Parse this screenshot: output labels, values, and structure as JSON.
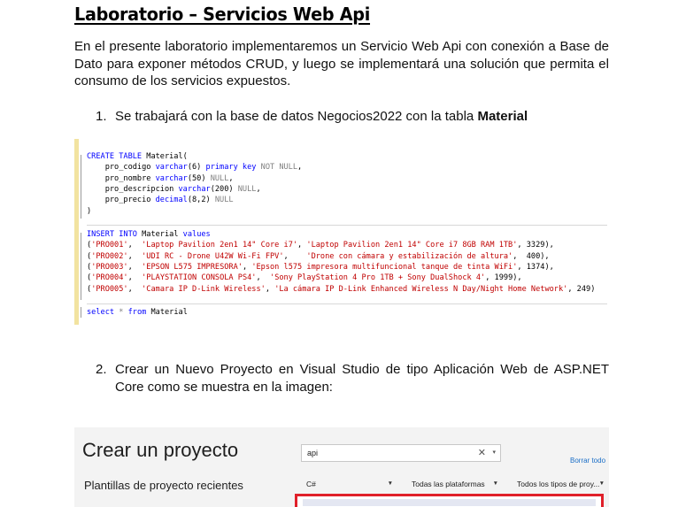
{
  "title": "Laboratorio – Servicios Web Api",
  "intro": "En el presente laboratorio implementaremos un Servicio Web Api con conexión a Base de Dato para exponer métodos CRUD, y luego se implementará una solución que permita el consumo de los servicios expuestos.",
  "steps": [
    {
      "num": "1.",
      "text_prefix": "Se trabajará con la base de datos Negocios2022 con la tabla ",
      "text_bold": "Material"
    },
    {
      "num": "2.",
      "text": "Crear un Nuevo Proyecto en Visual Studio de tipo Aplicación Web de ASP.NET Core como se muestra en la imagen:"
    }
  ],
  "code": {
    "create_table": [
      "CREATE TABLE Material(",
      "    pro_codigo varchar(6) primary key NOT NULL,",
      "    pro_nombre varchar(50) NULL,",
      "    pro_descripcion varchar(200) NULL,",
      "    pro_precio decimal(8,2) NULL",
      ")"
    ],
    "insert": [
      "INSERT INTO Material values",
      "('PRO001',  'Laptop Pavilion 2en1 14\" Core i7', 'Laptop Pavilion 2en1 14\" Core i7 8GB RAM 1TB', 3329),",
      "('PRO002',  'UDI RC - Drone U42W Wi-Fi FPV',    'Drone con cámara y estabilización de altura',  400),",
      "('PRO003',  'EPSON L575 IMPRESORA', 'Epson l575 impresora multifuncional tanque de tinta WiFi', 1374),",
      "('PRO004',  'PLAYSTATION CONSOLA PS4',  'Sony PlayStation 4 Pro 1TB + Sony DualShock 4', 1999),",
      "('PRO005',  'Camara IP D-Link Wireless', 'La cámara IP D-Link Enhanced Wireless N Day/Night Home Network', 249)"
    ],
    "select": "select * from Material"
  },
  "vs_dialog": {
    "title": "Crear un proyecto",
    "recent_label": "Plantillas de proyecto recientes",
    "search_value": "api",
    "clear_label": "Borrar todo",
    "language_filter": "C#",
    "platform_filter": "Todas las plataformas",
    "type_filter": "Todos los tipos de proy...",
    "colors": {
      "highlight_border": "#e0202a",
      "link": "#1a6ec7"
    }
  }
}
